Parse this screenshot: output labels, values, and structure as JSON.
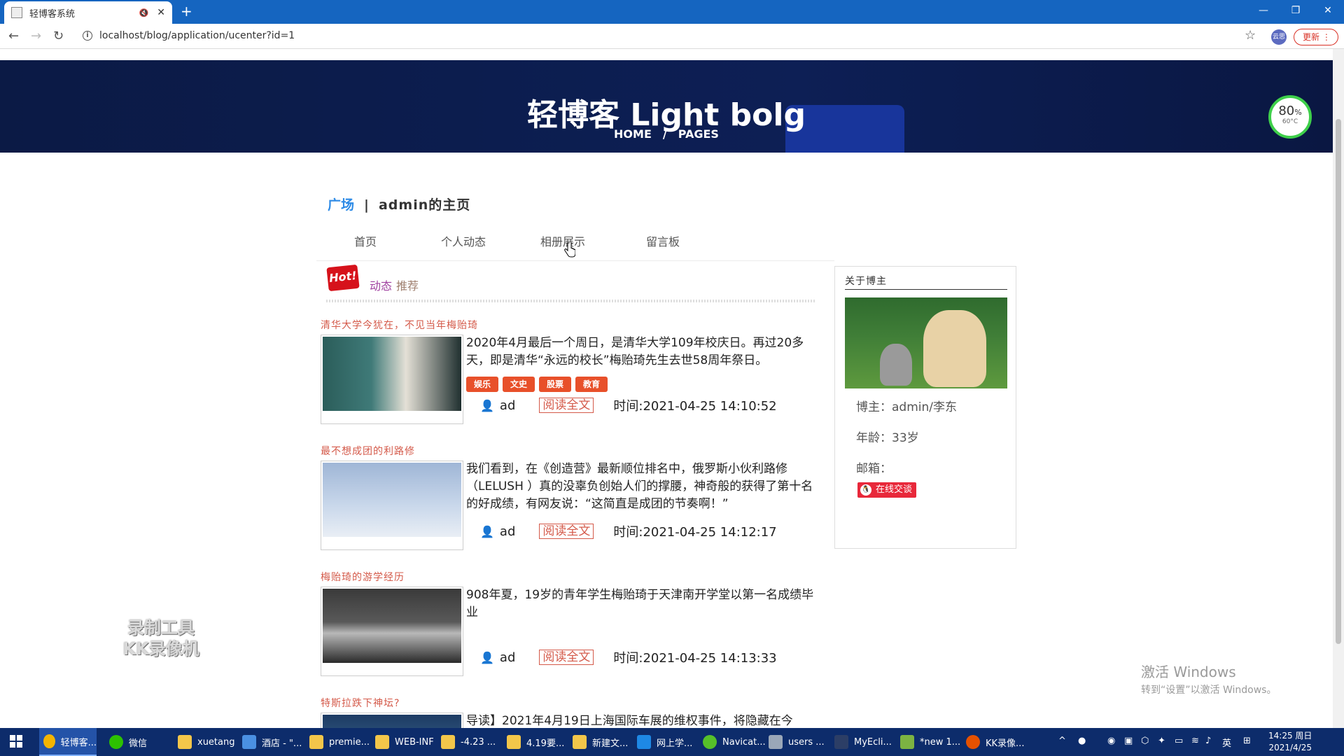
{
  "browser": {
    "tab_title": "轻博客系统",
    "url": "localhost/blog/application/ucenter?id=1",
    "update_label": "更新",
    "profile_label": "云思"
  },
  "hero": {
    "title": "轻博客 Light bolg",
    "crumb_home": "HOME",
    "crumb_sep": "/",
    "crumb_pages": "PAGES"
  },
  "monitor": {
    "percent": "80",
    "percent_unit": "%",
    "temp": "60°C"
  },
  "site": {
    "square": "广场",
    "divider": "|",
    "home_title": "admin的主页"
  },
  "nav": [
    "首页",
    "个人动态",
    "相册展示",
    "留言板"
  ],
  "recommend": {
    "hot": "Hot!",
    "label_a": "动态",
    "label_b": "推荐"
  },
  "posts": [
    {
      "title": "清华大学今犹在，不见当年梅贻琦",
      "excerpt": "2020年4月最后一个周日，是清华大学109年校庆日。再过20多天，即是清华“永远的校长”梅贻琦先生去世58周年祭日。",
      "tags": [
        "娱乐",
        "文史",
        "股票",
        "教育"
      ],
      "author": "ad",
      "read": "阅读全文",
      "time": "时间:2021-04-25 14:10:52"
    },
    {
      "title": "最不想成团的利路修",
      "excerpt": "我们看到，在《创造营》最新顺位排名中，俄罗斯小伙利路修（LELUSH ）真的没辜负创始人们的撑腰，神奇般的获得了第十名的好成绩，有网友说：“这简直是成团的节奏啊！”",
      "tags": [],
      "author": "ad",
      "read": "阅读全文",
      "time": "时间:2021-04-25 14:12:17"
    },
    {
      "title": "梅贻琦的游学经历",
      "excerpt": "908年夏，19岁的青年学生梅贻琦于天津南开学堂以第一名成绩毕业",
      "tags": [],
      "author": "ad",
      "read": "阅读全文",
      "time": "时间:2021-04-25 14:13:33"
    },
    {
      "title": "特斯拉跌下神坛?",
      "excerpt": "导读】2021年4月19日上海国际车展的维权事件，将隐藏在今",
      "tags": [],
      "author": "",
      "read": "",
      "time": ""
    }
  ],
  "about": {
    "heading": "关于博主",
    "blogger": "博主：admin/李东",
    "age": "年龄：33岁",
    "email": "邮箱：",
    "chat": "在线交谈"
  },
  "overlay": {
    "watermark_1": "录制工具",
    "watermark_2": "KK录像机",
    "activate_1": "激活 Windows",
    "activate_2": "转到“设置”以激活 Windows。"
  },
  "taskbar": {
    "items": [
      "轻博客...",
      "微信",
      "xuetang",
      "酒店 - \"...",
      "premie...",
      "WEB-INF",
      "-4.23 ...",
      "4.19要...",
      "新建文...",
      "网上学...",
      "Navicat...",
      "users ...",
      "MyEcli...",
      "*new 1...",
      "KK录像..."
    ],
    "ime": "英",
    "time": "14:25 周日",
    "date": "2021/4/25"
  },
  "colors": {
    "tabbar": "#1565c0",
    "hero": "#0d1f55",
    "accent_blue": "#2e8be6",
    "tag_orange": "#e8502a",
    "title_red": "#d45a4a",
    "taskbar": "#0d2c6b"
  }
}
